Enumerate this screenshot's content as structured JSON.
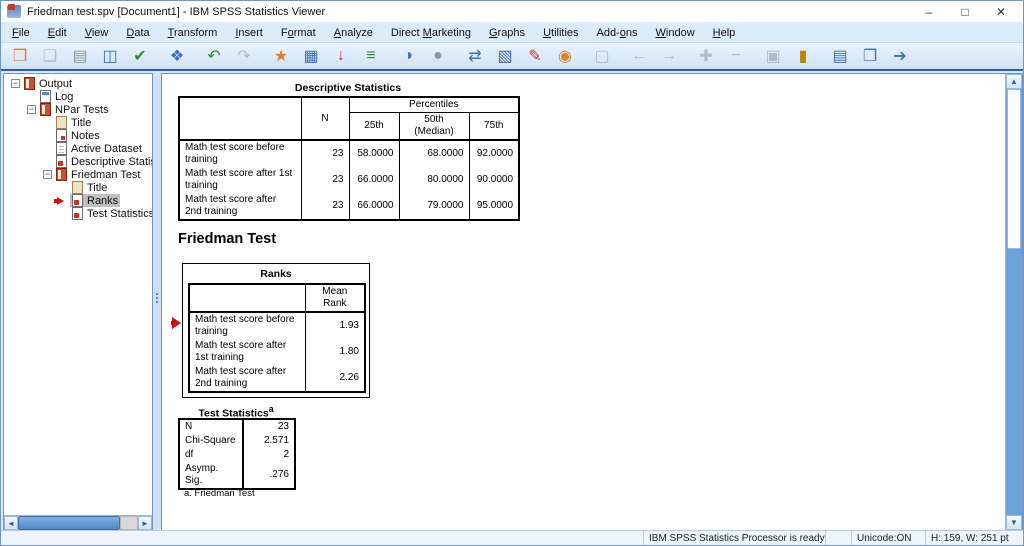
{
  "theme": {
    "accent_blue": "#3f6fb5",
    "toolbar_line": "#2f5e9e",
    "selection_gray": "#bfbfbf",
    "pointer_red": "#cc1111"
  },
  "window": {
    "title": "Friedman test.spv [Document1] - IBM SPSS Statistics Viewer"
  },
  "menu": {
    "items": [
      {
        "pre": "",
        "accel": "F",
        "post": "ile"
      },
      {
        "pre": "",
        "accel": "E",
        "post": "dit"
      },
      {
        "pre": "",
        "accel": "V",
        "post": "iew"
      },
      {
        "pre": "",
        "accel": "D",
        "post": "ata"
      },
      {
        "pre": "",
        "accel": "T",
        "post": "ransform"
      },
      {
        "pre": "",
        "accel": "I",
        "post": "nsert"
      },
      {
        "pre": "F",
        "accel": "o",
        "post": "rmat"
      },
      {
        "pre": "",
        "accel": "A",
        "post": "nalyze"
      },
      {
        "pre": "Direct ",
        "accel": "M",
        "post": "arketing"
      },
      {
        "pre": "",
        "accel": "G",
        "post": "raphs"
      },
      {
        "pre": "",
        "accel": "U",
        "post": "tilities"
      },
      {
        "pre": "Add-",
        "accel": "o",
        "post": "ns"
      },
      {
        "pre": "",
        "accel": "W",
        "post": "indow"
      },
      {
        "pre": "",
        "accel": "H",
        "post": "elp"
      }
    ]
  },
  "toolbar": {
    "icons": [
      {
        "name": "open-file",
        "glyph": "❒"
      },
      {
        "name": "save",
        "glyph": "❑"
      },
      {
        "name": "print",
        "glyph": "▤"
      },
      {
        "name": "print-preview",
        "glyph": "◫"
      },
      {
        "name": "export",
        "glyph": "✔"
      },
      {
        "name": "designate-window",
        "glyph": "❖"
      },
      {
        "name": "undo",
        "glyph": "↶"
      },
      {
        "name": "redo",
        "glyph": "↷"
      },
      {
        "name": "goto-data",
        "glyph": "★"
      },
      {
        "name": "goto-case",
        "glyph": "▦"
      },
      {
        "name": "variables",
        "glyph": "↓"
      },
      {
        "name": "use-variable-sets",
        "glyph": "≡"
      },
      {
        "name": "select-cases",
        "glyph": "◑"
      },
      {
        "name": "split-file",
        "glyph": "●"
      },
      {
        "name": "weight-cases",
        "glyph": "⇄"
      },
      {
        "name": "rebuild-chart",
        "glyph": "▧"
      },
      {
        "name": "edit-output",
        "glyph": "✎"
      },
      {
        "name": "run-script",
        "glyph": "◉"
      },
      {
        "name": "screen-reader",
        "glyph": "▢"
      },
      {
        "name": "promote",
        "glyph": "←"
      },
      {
        "name": "demote",
        "glyph": "→"
      },
      {
        "name": "expand",
        "glyph": "✚"
      },
      {
        "name": "collapse",
        "glyph": "−"
      },
      {
        "name": "show-hide",
        "glyph": "▣"
      },
      {
        "name": "insert-heading",
        "glyph": "▮"
      },
      {
        "name": "insert-title",
        "glyph": "▤"
      },
      {
        "name": "insert-text",
        "glyph": "❐"
      },
      {
        "name": "export-output",
        "glyph": "➔"
      }
    ]
  },
  "sidebar": {
    "items": [
      {
        "label": "Output"
      },
      {
        "label": "Log"
      },
      {
        "label": "NPar Tests"
      },
      {
        "label": "Title"
      },
      {
        "label": "Notes"
      },
      {
        "label": "Active Dataset"
      },
      {
        "label": "Descriptive Statistics"
      },
      {
        "label": "Friedman Test"
      },
      {
        "label": "Title"
      },
      {
        "label": "Ranks"
      },
      {
        "label": "Test Statistics"
      }
    ]
  },
  "content": {
    "descriptives": {
      "title": "Descriptive Statistics",
      "group_header": "Percentiles",
      "col_n": "N",
      "col_p25": "25th",
      "col_p50": "50th (Median)",
      "col_p75": "75th",
      "rows": [
        {
          "label": "Math test score before training",
          "n": "23",
          "p25": "58.0000",
          "p50": "68.0000",
          "p75": "92.0000"
        },
        {
          "label": "Math test score after 1st training",
          "n": "23",
          "p25": "66.0000",
          "p50": "80.0000",
          "p75": "90.0000"
        },
        {
          "label": "Math test score after 2nd training",
          "n": "23",
          "p25": "66.0000",
          "p50": "79.0000",
          "p75": "95.0000"
        }
      ]
    },
    "section_heading": "Friedman Test",
    "ranks": {
      "title": "Ranks",
      "col": "Mean Rank",
      "rows": [
        {
          "label": "Math test score before training",
          "value": "1.93"
        },
        {
          "label": "Math test score after 1st training",
          "value": "1.80"
        },
        {
          "label": "Math test score after 2nd training",
          "value": "2.26"
        }
      ]
    },
    "test_statistics": {
      "title": "Test Statistics",
      "sup": "a",
      "rows": [
        {
          "label": "N",
          "value": "23"
        },
        {
          "label": "Chi-Square",
          "value": "2.571"
        },
        {
          "label": "df",
          "value": "2"
        },
        {
          "label": "Asymp. Sig.",
          "value": ".276"
        }
      ],
      "footnote": "a. Friedman Test"
    }
  },
  "status": {
    "message": "IBM SPSS Statistics Processor is ready",
    "unicode": "Unicode:ON",
    "size": "H: 159, W: 251 pt"
  }
}
